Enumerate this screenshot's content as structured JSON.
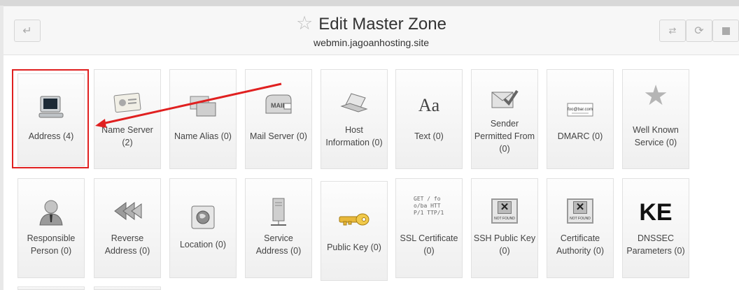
{
  "header": {
    "title": "Edit Master Zone",
    "subtitle": "webmin.jagoanhosting.site"
  },
  "colors": {
    "highlight": "#e02020",
    "accent_arrow": "#e02020"
  },
  "row1": [
    {
      "label": "Address (4)",
      "icon": "monitor-icon"
    },
    {
      "label": "Name Server (2)",
      "icon": "id-card-icon"
    },
    {
      "label": "Name Alias (0)",
      "icon": "windows-icon"
    },
    {
      "label": "Mail Server (0)",
      "icon": "mailbox-icon",
      "icon_text": "MAIL"
    },
    {
      "label": "Host Information (0)",
      "icon": "laptop-icon"
    },
    {
      "label": "Text (0)",
      "icon": "text-aa-icon",
      "icon_text": "Aa"
    },
    {
      "label": "Sender Permitted From (0)",
      "icon": "mail-check-icon"
    },
    {
      "label": "DMARC (0)",
      "icon": "business-card-icon",
      "icon_text": "foo@bar.com"
    },
    {
      "label": "Well Known Service (0)",
      "icon": "star-icon"
    }
  ],
  "row2": [
    {
      "label": "Responsible Person (0)",
      "icon": "person-icon"
    },
    {
      "label": "Reverse Address (0)",
      "icon": "rewind-icon"
    },
    {
      "label": "Location (0)",
      "icon": "globe-icon"
    },
    {
      "label": "Service Address (0)",
      "icon": "server-icon"
    },
    {
      "label": "Public Key (0)",
      "icon": "key-icon"
    },
    {
      "label": "SSL Certificate (0)",
      "icon": "certificate-text-icon",
      "icon_text": "GET / foo/ba HTTP/1 TTP/1"
    },
    {
      "label": "SSH Public Key (0)",
      "icon": "image-not-found-icon",
      "icon_text": "NOT FOUND"
    },
    {
      "label": "Certificate Authority (0)",
      "icon": "image-not-found-icon",
      "icon_text": "NOT FOUND"
    },
    {
      "label": "DNSSEC Parameters (0)",
      "icon": "key-letters-icon",
      "icon_text": "KE"
    }
  ]
}
